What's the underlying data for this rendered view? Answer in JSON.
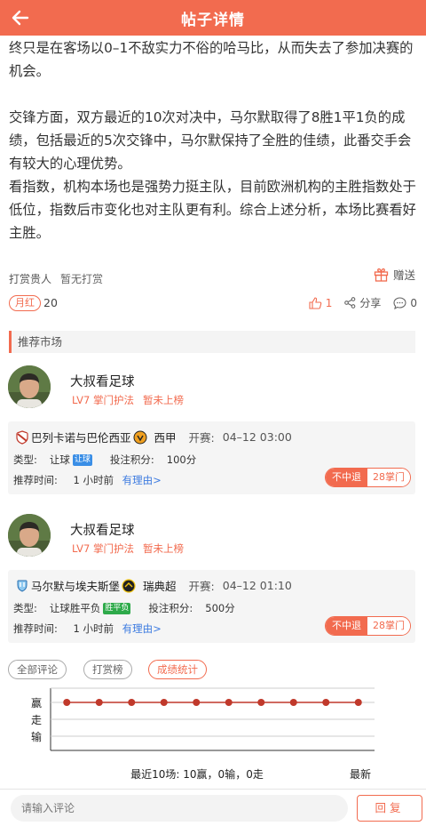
{
  "header": {
    "title": "帖子详情",
    "back_icon": "back-arrow-icon"
  },
  "article": {
    "p1": "终只是在客场以0–1不敌实力不俗的哈马比，从而失去了参加决赛的机会。",
    "p2": "交锋方面，双方最近的10次对决中，马尔默取得了8胜1平1负的成绩，包括最近的5次交锋中，马尔默保持了全胜的佳绩，此番交手会有较大的心理优势。",
    "p3": "看指数，机构本场也是强势力挺主队，目前欧洲机构的主胜指数处于低位，指数后市变化也对主队更有利。综合上述分析，本场比赛看好主胜。"
  },
  "reward": {
    "label": "打赏贵人",
    "value": "暂无打赏",
    "gift_label": "赠送",
    "gift_icon": "gift-icon"
  },
  "stats": {
    "badge": "月红",
    "badge_count": "20",
    "likes": "1",
    "share_label": "分享",
    "comments": "0"
  },
  "section": {
    "title": "推荐市场"
  },
  "recommendations": [
    {
      "user": "大叔看足球",
      "level": "LV7 掌门护法",
      "rank": "暂未上榜",
      "match": "巴列卡诺与巴伦西亚",
      "league": "西甲",
      "start_label": "开赛:",
      "start_time": "04–12 03:00",
      "type_label": "类型:",
      "type_value": "让球",
      "type_tag": "让球",
      "points_label": "投注积分:",
      "points_value": "100分",
      "time_label": "推荐时间:",
      "time_value": "1 小时前",
      "reason_link": "有理由>",
      "refund_label": "不中退",
      "price": "28掌门"
    },
    {
      "user": "大叔看足球",
      "level": "LV7 掌门护法",
      "rank": "暂未上榜",
      "match": "马尔默与埃夫斯堡",
      "league": "瑞典超",
      "start_label": "开赛:",
      "start_time": "04–12 01:10",
      "type_label": "类型:",
      "type_value": "让球胜平负",
      "type_tag": "胜平负",
      "points_label": "投注积分:",
      "points_value": "500分",
      "time_label": "推荐时间:",
      "time_value": "1 小时前",
      "reason_link": "有理由>",
      "refund_label": "不中退",
      "price": "28掌门"
    }
  ],
  "tabs": {
    "all": "全部评论",
    "reward": "打赏榜",
    "record": "成绩统计"
  },
  "chart_data": {
    "type": "line",
    "y_categories": [
      "赢",
      "走",
      "输"
    ],
    "values": [
      "赢",
      "赢",
      "赢",
      "赢",
      "赢",
      "赢",
      "赢",
      "赢",
      "赢",
      "赢"
    ],
    "summary": "最近10场: 10赢，0输，0走",
    "latest_label": "最新",
    "color": "#c0392b"
  },
  "comment": {
    "placeholder": "请输入评论",
    "reply": "回复"
  },
  "colors": {
    "accent": "#f26b4f",
    "link": "#3d7be0"
  }
}
